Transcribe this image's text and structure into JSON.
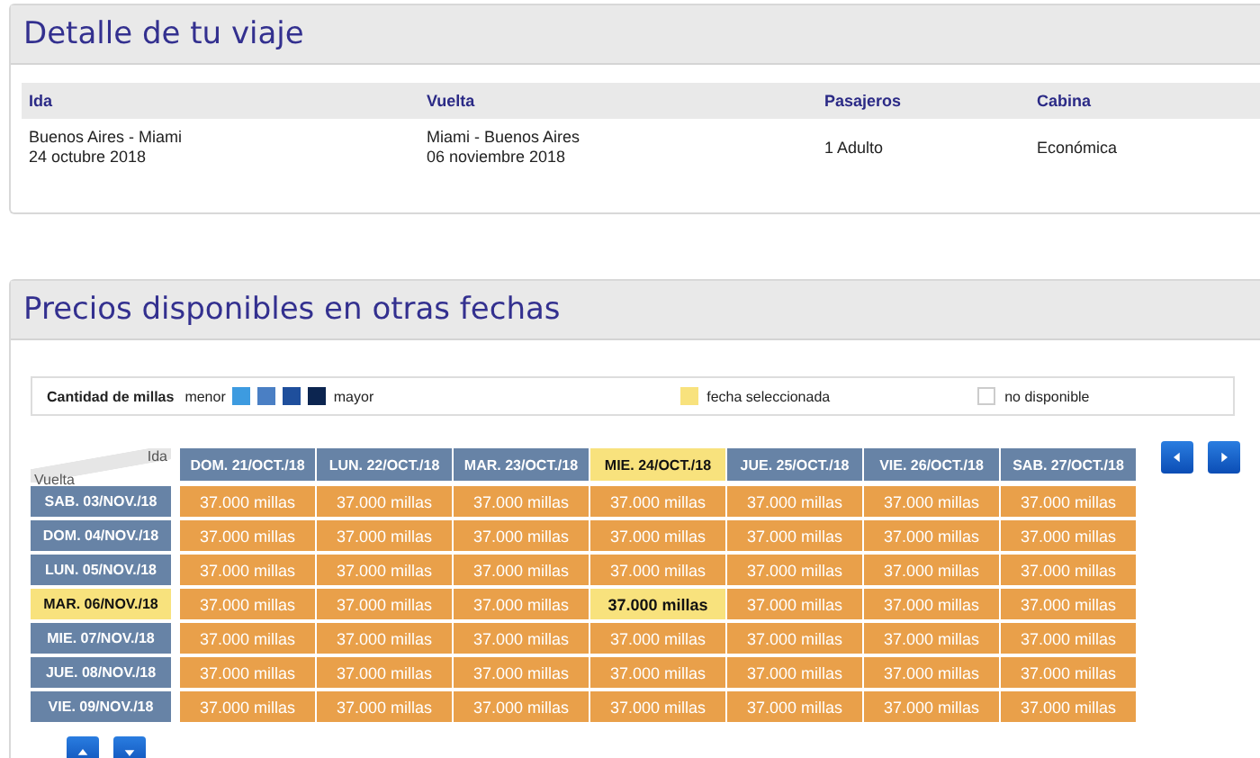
{
  "trip": {
    "title": "Detalle de tu viaje",
    "columns": [
      "Ida",
      "Vuelta",
      "Pasajeros",
      "Cabina"
    ],
    "values": [
      [
        "Buenos Aires - Miami",
        "24 octubre 2018"
      ],
      [
        "Miami - Buenos Aires",
        "06 noviembre 2018"
      ],
      [
        "1 Adulto"
      ],
      [
        "Económica"
      ]
    ]
  },
  "prices": {
    "title": "Precios disponibles en otras fechas",
    "legend": {
      "label": "Cantidad de millas",
      "low": "menor",
      "high": "mayor",
      "scale": [
        {
          "color": "#3d9be0"
        },
        {
          "color": "#4a7fc4"
        },
        {
          "color": "#1f4f9c"
        },
        {
          "color": "#0c2550"
        }
      ],
      "selected": "fecha seleccionada",
      "unavailable": "no disponible"
    },
    "corner": {
      "across": "Ida",
      "down": "Vuelta"
    },
    "columns": [
      {
        "label": "DOM. 21/OCT./18",
        "selected": false
      },
      {
        "label": "LUN. 22/OCT./18",
        "selected": false
      },
      {
        "label": "MAR. 23/OCT./18",
        "selected": false
      },
      {
        "label": "MIE. 24/OCT./18",
        "selected": true
      },
      {
        "label": "JUE. 25/OCT./18",
        "selected": false
      },
      {
        "label": "VIE. 26/OCT./18",
        "selected": false
      },
      {
        "label": "SAB. 27/OCT./18",
        "selected": false
      }
    ],
    "rows": [
      {
        "label": "SAB. 03/NOV./18",
        "selected": false,
        "cells": [
          "37.000 millas",
          "37.000 millas",
          "37.000 millas",
          "37.000 millas",
          "37.000 millas",
          "37.000 millas",
          "37.000 millas"
        ]
      },
      {
        "label": "DOM. 04/NOV./18",
        "selected": false,
        "cells": [
          "37.000 millas",
          "37.000 millas",
          "37.000 millas",
          "37.000 millas",
          "37.000 millas",
          "37.000 millas",
          "37.000 millas"
        ]
      },
      {
        "label": "LUN. 05/NOV./18",
        "selected": false,
        "cells": [
          "37.000 millas",
          "37.000 millas",
          "37.000 millas",
          "37.000 millas",
          "37.000 millas",
          "37.000 millas",
          "37.000 millas"
        ]
      },
      {
        "label": "MAR. 06/NOV./18",
        "selected": true,
        "cells": [
          "37.000 millas",
          "37.000 millas",
          "37.000 millas",
          "37.000 millas",
          "37.000 millas",
          "37.000 millas",
          "37.000 millas"
        ]
      },
      {
        "label": "MIE. 07/NOV./18",
        "selected": false,
        "cells": [
          "37.000 millas",
          "37.000 millas",
          "37.000 millas",
          "37.000 millas",
          "37.000 millas",
          "37.000 millas",
          "37.000 millas"
        ]
      },
      {
        "label": "JUE. 08/NOV./18",
        "selected": false,
        "cells": [
          "37.000 millas",
          "37.000 millas",
          "37.000 millas",
          "37.000 millas",
          "37.000 millas",
          "37.000 millas",
          "37.000 millas"
        ]
      },
      {
        "label": "VIE. 09/NOV./18",
        "selected": false,
        "cells": [
          "37.000 millas",
          "37.000 millas",
          "37.000 millas",
          "37.000 millas",
          "37.000 millas",
          "37.000 millas",
          "37.000 millas"
        ]
      }
    ]
  }
}
